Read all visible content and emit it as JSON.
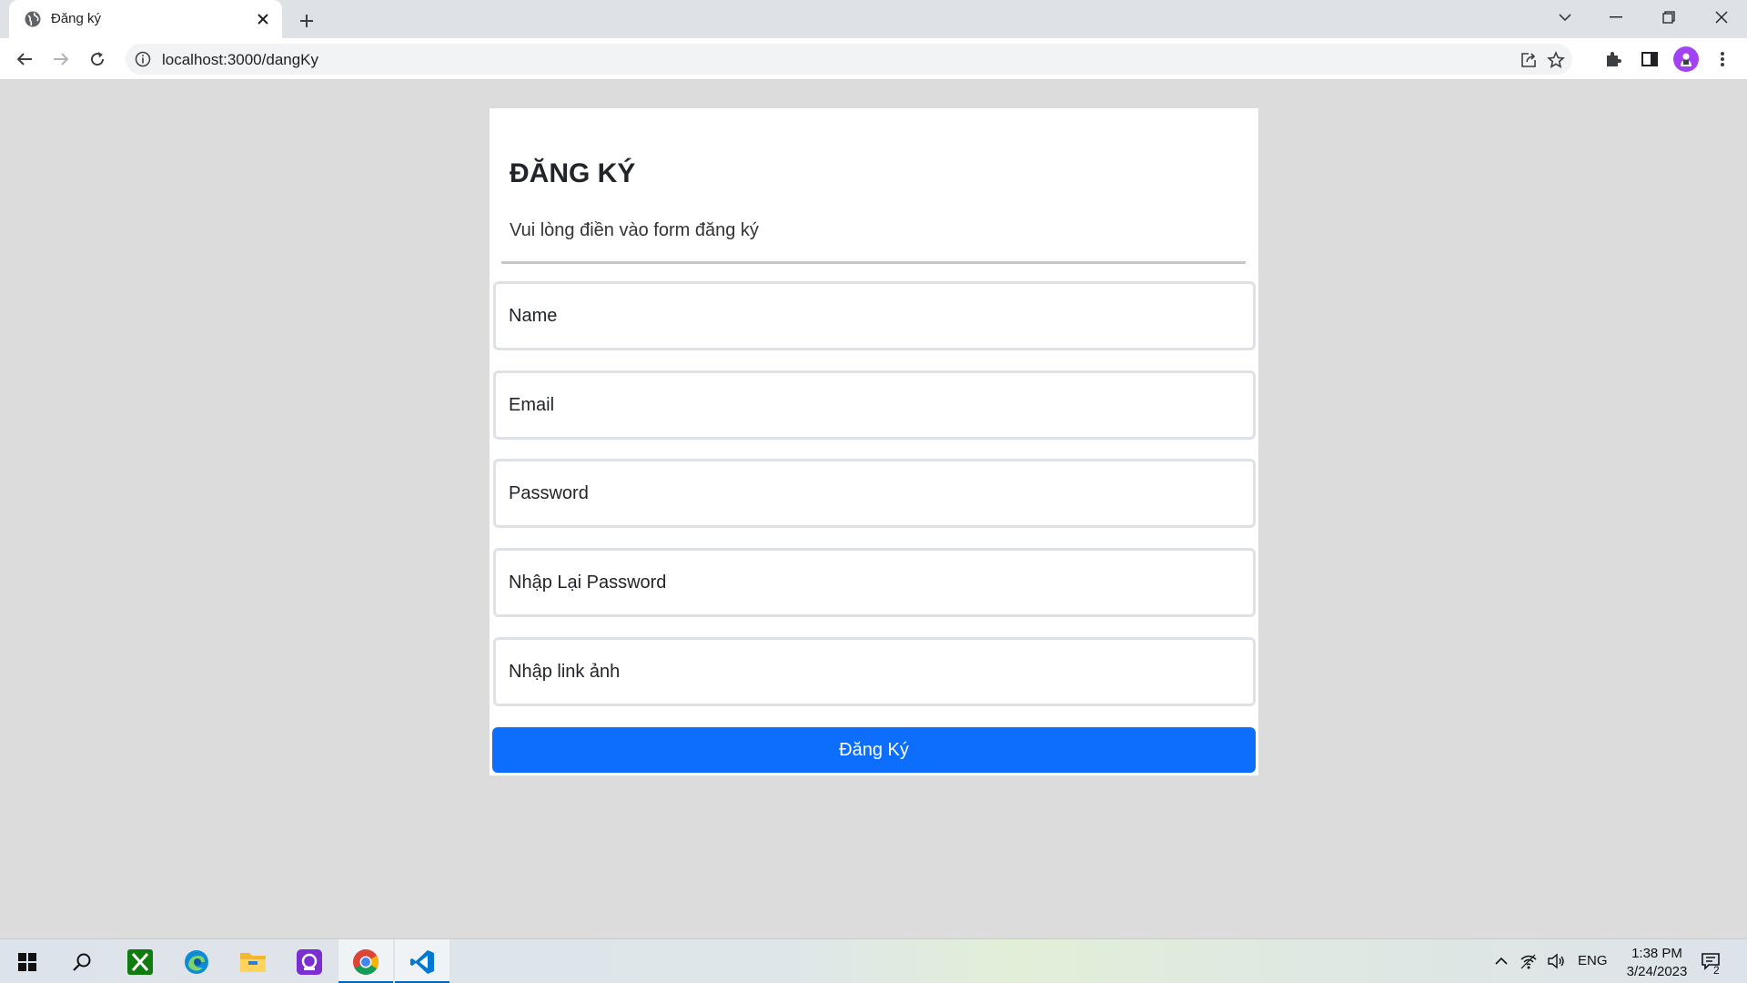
{
  "browser": {
    "tab_title": "Đăng ký",
    "url": "localhost:3000/dangKy",
    "icons": {
      "favicon": "globe-icon",
      "tab_close": "close-icon",
      "new_tab": "plus-icon",
      "back": "arrow-left-icon",
      "forward": "arrow-right-icon",
      "reload": "reload-icon",
      "info": "info-icon",
      "share": "share-icon",
      "bookmark": "star-icon",
      "extensions": "puzzle-icon",
      "side_panel": "side-panel-icon",
      "menu": "kebab-menu-icon"
    },
    "accent": "#a142f4"
  },
  "form": {
    "title": "ĐĂNG KÝ",
    "subtitle": "Vui lòng điền vào form đăng ký",
    "fields": [
      {
        "placeholder": "Name",
        "value": ""
      },
      {
        "placeholder": "Email",
        "value": ""
      },
      {
        "placeholder": "Password",
        "value": ""
      },
      {
        "placeholder": "Nhập Lại Password",
        "value": ""
      },
      {
        "placeholder": "Nhập link ảnh",
        "value": ""
      }
    ],
    "submit_label": "Đăng Ký",
    "submit_color": "#0d6efd"
  },
  "taskbar": {
    "apps": [
      "windows-start-icon",
      "search-icon",
      "xbox-icon",
      "edge-icon",
      "file-explorer-icon",
      "app-icon",
      "chrome-icon",
      "vscode-icon"
    ],
    "language": "ENG",
    "time": "1:38 PM",
    "date": "3/24/2023",
    "notification_count": "2"
  }
}
